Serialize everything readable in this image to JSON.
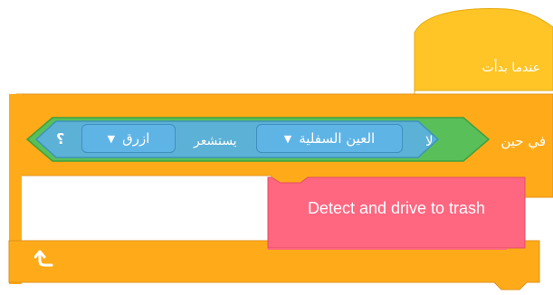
{
  "blocks": {
    "hat": {
      "label": "عندما بدأت"
    },
    "while_loop": {
      "label": "في حين",
      "loop_icon": "loop-arrow-icon"
    },
    "not_op": {
      "label": "لا"
    },
    "sensor_condition": {
      "sensor_dropdown": "العين السفلية",
      "verb": "يستشعر",
      "color_dropdown": "ازرق",
      "question_mark": "؟",
      "dropdown_icon": "triangle-down-icon"
    },
    "custom_block": {
      "label": "Detect and drive to trash"
    }
  },
  "colors": {
    "events_yellow": "#ffca28",
    "control_orange": "#ffab19",
    "operator_green": "#59c059",
    "sensing_blue": "#5cb1d6",
    "custom_pink": "#ff6680"
  }
}
